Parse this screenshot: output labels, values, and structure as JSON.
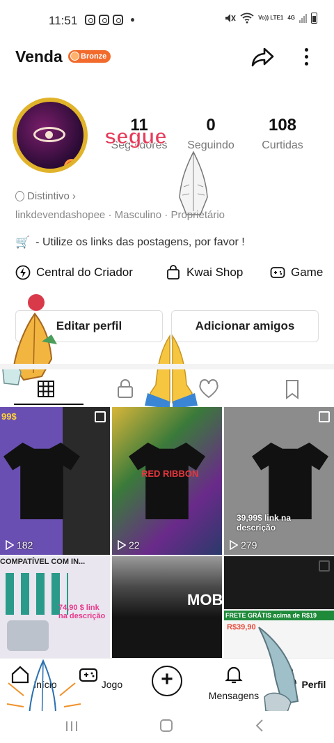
{
  "status_bar": {
    "time": "11:51",
    "network_label": "Vo)) LTE1",
    "network_type": "4G"
  },
  "header": {
    "username": "Venda",
    "level_badge": "Bronze"
  },
  "profile": {
    "stats": [
      {
        "value": "11",
        "label": "Seguidores"
      },
      {
        "value": "0",
        "label": "Seguindo"
      },
      {
        "value": "108",
        "label": "Curtidas"
      }
    ],
    "sticker_text": "segue",
    "distintivo": "Distintivo",
    "info_line": "linkdevendashopee · Masculino · Proprietário",
    "bio": "- Utilize os links das postagens, por favor !"
  },
  "shortcuts": [
    {
      "label": "Central do Criador",
      "icon": "lightning-icon"
    },
    {
      "label": "Kwai Shop",
      "icon": "shopping-bag-icon"
    },
    {
      "label": "Game",
      "icon": "gamepad-icon"
    }
  ],
  "actions": {
    "edit_profile": "Editar perfil",
    "add_friends": "Adicionar amigos"
  },
  "tabs": [
    {
      "icon": "grid-icon",
      "active": true
    },
    {
      "icon": "lock-icon",
      "active": false
    },
    {
      "icon": "heart-icon",
      "active": false
    },
    {
      "icon": "bookmark-icon",
      "active": false
    }
  ],
  "posts": [
    {
      "views": "182",
      "caption": "99$",
      "color": "#6a4fb2"
    },
    {
      "views": "22",
      "caption": "RED RIBBON",
      "color": "#2a6b3a"
    },
    {
      "views": "279",
      "caption": "39,99$ link na descrição",
      "color": "#8c8c8c"
    },
    {
      "caption": "COMPATÍVEL COM IN...",
      "sub": "74,90 $ link na descrição",
      "color": "#e9e6f0"
    },
    {
      "caption": "MOB",
      "color": "#202020"
    },
    {
      "caption": "FRETE GRÁTIS acima de R$19",
      "sub": "R$39,90",
      "color": "#f5f5f5"
    }
  ],
  "bottom_nav": [
    {
      "label": "Início",
      "icon": "home-icon"
    },
    {
      "label": "Jogo",
      "icon": "gamepad-icon"
    },
    {
      "label": "",
      "icon": "plus-icon"
    },
    {
      "label": "Mensagens",
      "icon": "bell-icon"
    },
    {
      "label": "Perfil",
      "icon": "person-icon"
    }
  ],
  "colors": {
    "badge": "#f26b2c",
    "sticker": "#e73b5a",
    "avatar_ring": "#e0b32a"
  }
}
